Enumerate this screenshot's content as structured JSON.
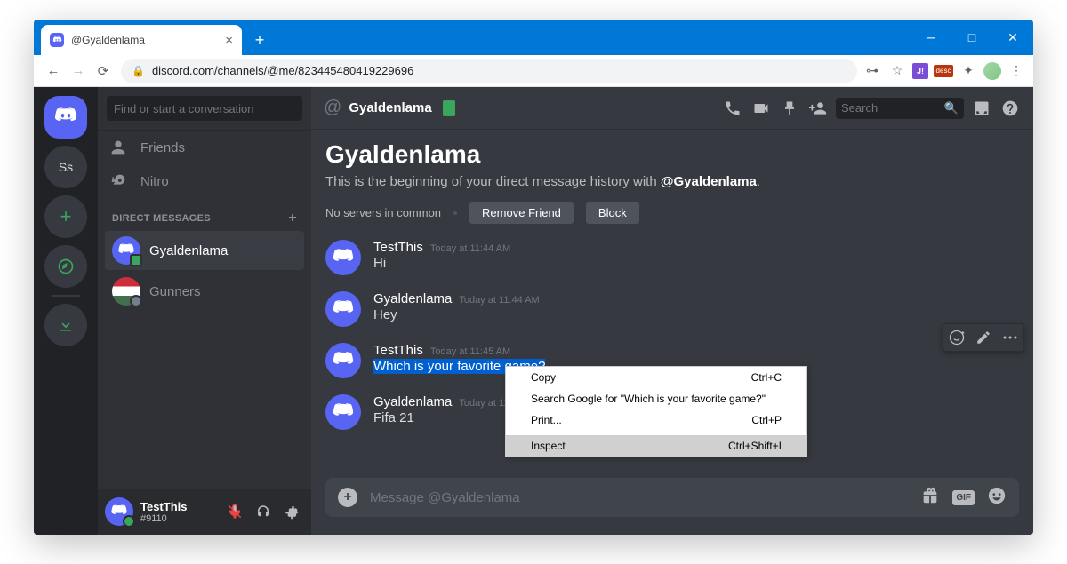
{
  "tab": {
    "title": "@Gyaldenlama"
  },
  "url": "discord.com/channels/@me/823445480419229696",
  "sidebar": {
    "search_placeholder": "Find or start a conversation",
    "friends": "Friends",
    "nitro": "Nitro",
    "dm_header": "DIRECT MESSAGES",
    "dms": [
      {
        "name": "Gyaldenlama"
      },
      {
        "name": "Gunners"
      }
    ]
  },
  "user_panel": {
    "name": "TestThis",
    "tag": "#9110"
  },
  "guild_labels": {
    "ss": "Ss"
  },
  "chat_header": {
    "name": "Gyaldenlama",
    "search_placeholder": "Search"
  },
  "welcome": {
    "title": "Gyaldenlama",
    "text_prefix": "This is the beginning of your direct message history with ",
    "handle": "@Gyaldenlama",
    "no_servers": "No servers in common",
    "remove": "Remove Friend",
    "block": "Block"
  },
  "messages": [
    {
      "author": "TestThis",
      "time": "Today at 11:44 AM",
      "text": "Hi"
    },
    {
      "author": "Gyaldenlama",
      "time": "Today at 11:44 AM",
      "text": "Hey"
    },
    {
      "author": "TestThis",
      "time": "Today at 11:45 AM",
      "text": "Which is your favorite game?"
    },
    {
      "author": "Gyaldenlama",
      "time": "Today at 11:",
      "text": "Fifa 21"
    }
  ],
  "input": {
    "placeholder": "Message @Gyaldenlama",
    "gif": "GIF"
  },
  "context_menu": {
    "copy": "Copy",
    "copy_sc": "Ctrl+C",
    "search": "Search Google for \"Which is your favorite game?\"",
    "print": "Print...",
    "print_sc": "Ctrl+P",
    "inspect": "Inspect",
    "inspect_sc": "Ctrl+Shift+I"
  },
  "ext_labels": {
    "j": "J!",
    "desc": "desc"
  }
}
